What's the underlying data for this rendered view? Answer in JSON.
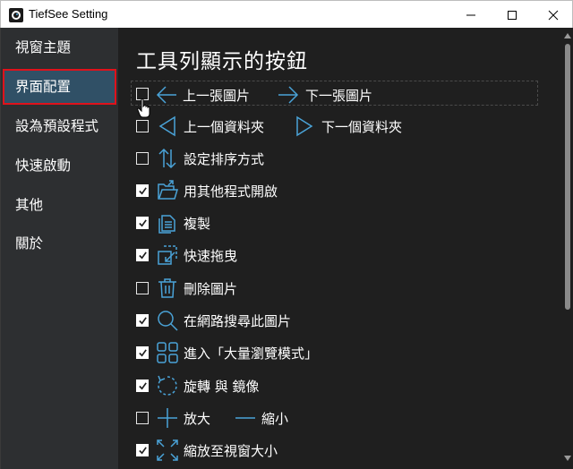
{
  "window": {
    "title": "TiefSee Setting"
  },
  "sidebar": {
    "items": [
      {
        "label": "視窗主題",
        "active": false
      },
      {
        "label": "界面配置",
        "active": true
      },
      {
        "label": "設為預設程式",
        "active": false
      },
      {
        "label": "快速啟動",
        "active": false
      },
      {
        "label": "其他",
        "active": false
      },
      {
        "label": "關於",
        "active": false
      }
    ]
  },
  "main": {
    "title": "工具列顯示的按鈕",
    "options": [
      {
        "checked": false,
        "icon": "arrow-left-icon",
        "label": "上一張圖片",
        "icon2": "arrow-right-icon",
        "label2": "下一張圖片"
      },
      {
        "checked": false,
        "icon": "triangle-left-icon",
        "label": "上一個資料夾",
        "icon2": "triangle-right-icon",
        "label2": "下一個資料夾"
      },
      {
        "checked": false,
        "icon": "sort-arrows-icon",
        "label": "設定排序方式"
      },
      {
        "checked": true,
        "icon": "open-folder-icon",
        "label": "用其他程式開啟"
      },
      {
        "checked": true,
        "icon": "copy-icon",
        "label": "複製"
      },
      {
        "checked": true,
        "icon": "drag-icon",
        "label": "快速拖曳"
      },
      {
        "checked": false,
        "icon": "trash-icon",
        "label": "刪除圖片"
      },
      {
        "checked": true,
        "icon": "search-icon",
        "label": "在網路搜尋此圖片"
      },
      {
        "checked": true,
        "icon": "grid-icon",
        "label": "進入「大量瀏覽模式」"
      },
      {
        "checked": true,
        "icon": "rotate-icon",
        "label": "旋轉 與 鏡像"
      },
      {
        "checked": false,
        "icon": "plus-icon",
        "label": "放大",
        "icon2": "minus-icon",
        "label2": "縮小"
      },
      {
        "checked": true,
        "icon": "fit-window-icon",
        "label": "縮放至視窗大小"
      }
    ]
  },
  "colors": {
    "accent": "#4aa3d8",
    "sidebar_active_bg": "#305066",
    "active_outline": "#e0121b"
  }
}
